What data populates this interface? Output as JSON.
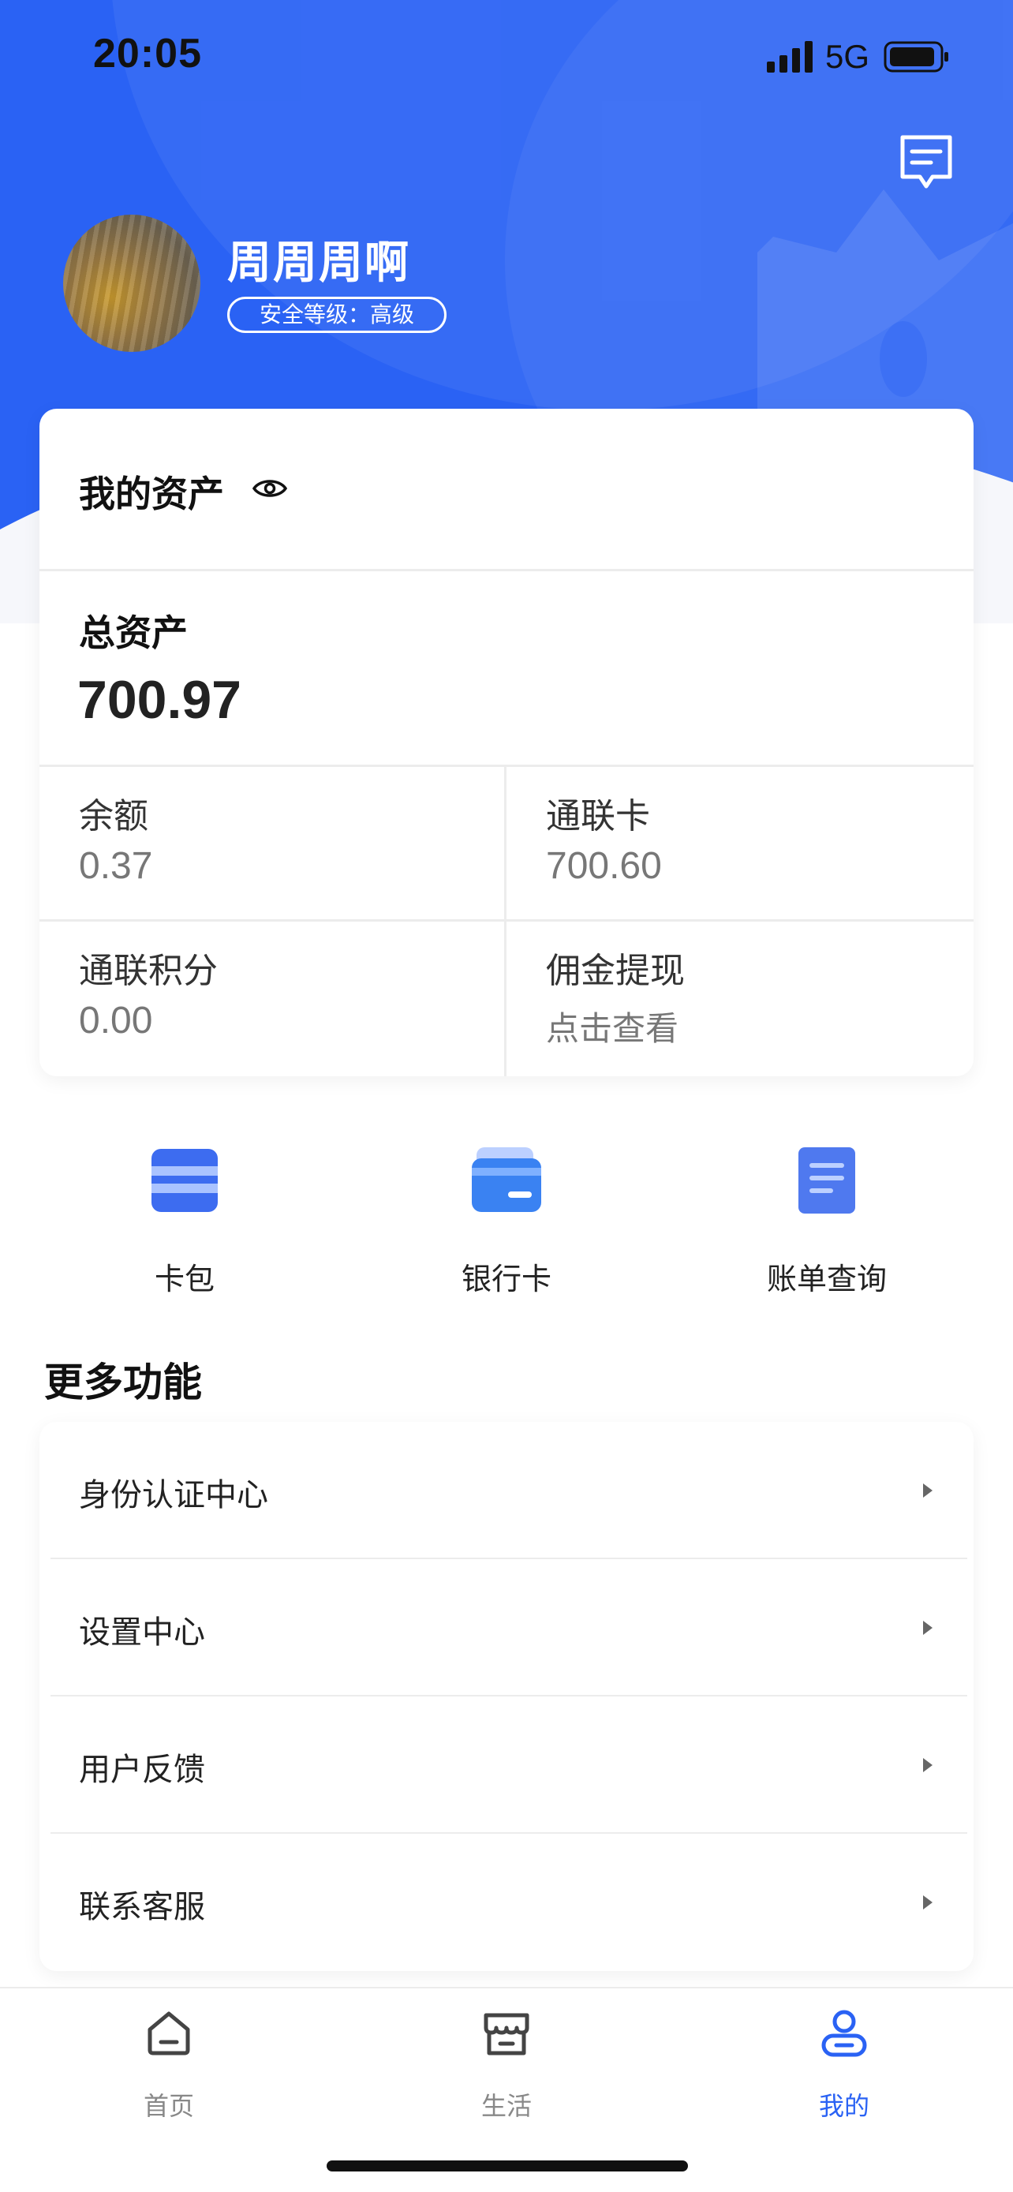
{
  "status_bar": {
    "time": "20:05",
    "network": "5G"
  },
  "profile": {
    "username": "周周周啊",
    "security_badge": "安全等级：高级"
  },
  "assets": {
    "title": "我的资产",
    "total_label": "总资产",
    "total_value": "700.97",
    "cells": [
      {
        "label": "余额",
        "value": "0.37"
      },
      {
        "label": "通联卡",
        "value": "700.60"
      },
      {
        "label": "通联积分",
        "value": "0.00"
      },
      {
        "label": "佣金提现",
        "value": "点击查看"
      }
    ]
  },
  "quick_actions": [
    {
      "label": "卡包",
      "icon": "card-pack-icon"
    },
    {
      "label": "银行卡",
      "icon": "bank-card-icon"
    },
    {
      "label": "账单查询",
      "icon": "bill-icon"
    }
  ],
  "more": {
    "title": "更多功能",
    "items": [
      {
        "label": "身份认证中心"
      },
      {
        "label": "设置中心"
      },
      {
        "label": "用户反馈"
      },
      {
        "label": "联系客服"
      }
    ]
  },
  "tabs": [
    {
      "label": "首页",
      "icon": "home-icon",
      "active": false
    },
    {
      "label": "生活",
      "icon": "store-icon",
      "active": false
    },
    {
      "label": "我的",
      "icon": "user-icon",
      "active": true
    }
  ],
  "colors": {
    "primary": "#2a62f4",
    "text": "#222222",
    "muted": "#777777",
    "divider": "#ececec"
  }
}
